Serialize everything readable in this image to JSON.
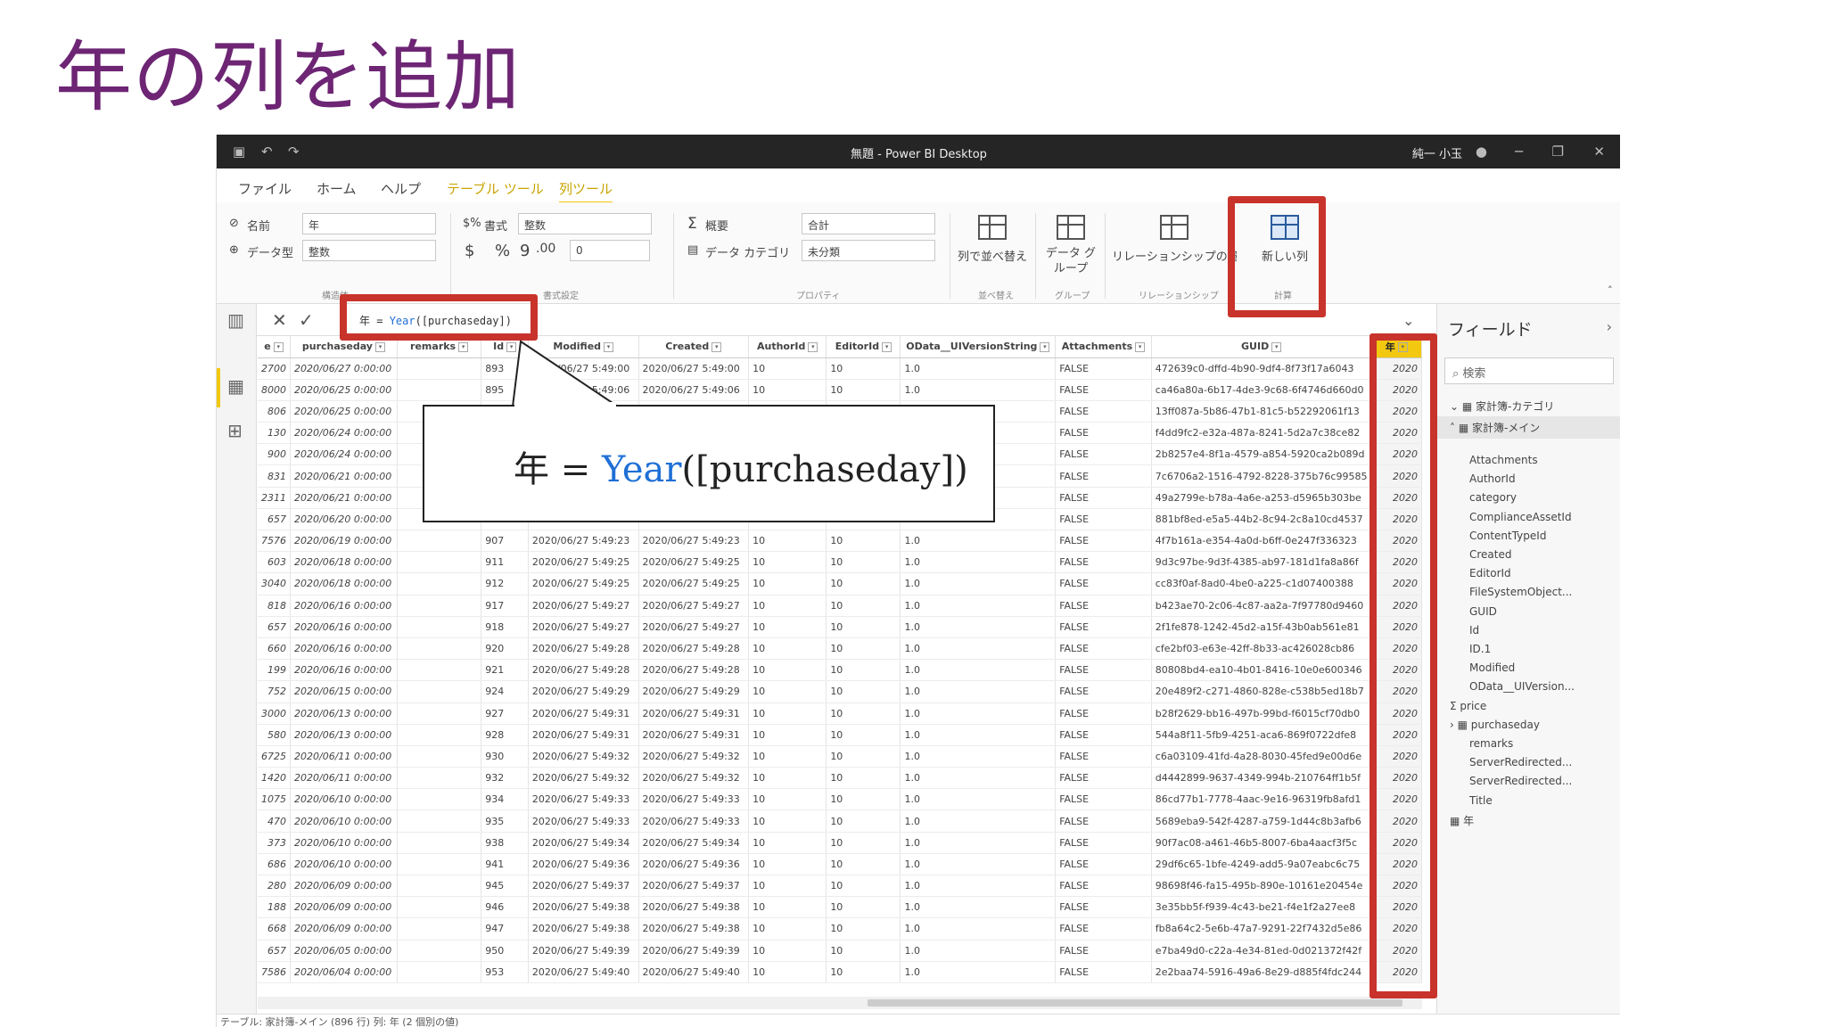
{
  "slide_title": "年の列を追加",
  "window": {
    "title": "無題 - Power BI Desktop",
    "user": "純一 小玉"
  },
  "menu": [
    "ファイル",
    "ホーム",
    "ヘルプ",
    "テーブル ツール",
    "列ツール"
  ],
  "ribbon": {
    "name_label": "名前",
    "name_value": "年",
    "datatype_label": "データ型",
    "datatype_value": "整数",
    "format_label": "書式",
    "format_value": "整数",
    "currency": "$",
    "percent": "%",
    "comma": "9",
    "decimals": "0",
    "summary_label": "概要",
    "summary_value": "合計",
    "category_label": "データ カテゴリ",
    "category_value": "未分類",
    "sort_label": "列で並べ替え",
    "group_label": "データ グループ",
    "relation_label": "リレーションシップの管理",
    "newcol_label": "新しい列",
    "groups": [
      "構造体",
      "書式設定",
      "プロパティ",
      "並べ替え",
      "グループ",
      "リレーションシップ",
      "計算"
    ]
  },
  "formula": {
    "prefix": "年 = ",
    "fn": "Year",
    "arg": "([purchaseday])"
  },
  "callout": {
    "prefix": "年 = ",
    "fn": "Year",
    "arg": "([purchaseday])"
  },
  "table": {
    "headers": [
      "e",
      "purchaseday",
      "remarks",
      "Id",
      "Modified",
      "Created",
      "AuthorId",
      "EditorId",
      "OData__UIVersionString",
      "Attachments",
      "GUID",
      "年"
    ],
    "rows": [
      [
        "2700",
        "2020/06/27 0:00:00",
        "",
        "893",
        "2020/06/27 5:49:00",
        "2020/06/27 5:49:00",
        "10",
        "10",
        "1.0",
        "FALSE",
        "472639c0-dffd-4b90-9df4-8f73f17a6043",
        "2020"
      ],
      [
        "8000",
        "2020/06/25 0:00:00",
        "",
        "895",
        "2020/06/27 5:49:06",
        "2020/06/27 5:49:06",
        "10",
        "10",
        "1.0",
        "FALSE",
        "ca46a80a-6b17-4de3-9c68-6f4746d660d0",
        "2020"
      ],
      [
        "806",
        "2020/06/25 0:00:00",
        "",
        "",
        "",
        "",
        "",
        "",
        "",
        "FALSE",
        "13ff087a-5b86-47b1-81c5-b52292061f13",
        "2020"
      ],
      [
        "130",
        "2020/06/24 0:00:00",
        "",
        "",
        "",
        "",
        "",
        "",
        "",
        "FALSE",
        "f4dd9fc2-e32a-487a-8241-5d2a7c38ce82",
        "2020"
      ],
      [
        "900",
        "2020/06/24 0:00:00",
        "",
        "",
        "",
        "",
        "",
        "",
        "",
        "FALSE",
        "2b8257e4-8f1a-4579-a854-5920ca2b089d",
        "2020"
      ],
      [
        "831",
        "2020/06/21 0:00:00",
        "",
        "",
        "",
        "",
        "",
        "",
        "",
        "FALSE",
        "7c6706a2-1516-4792-8228-375b76c99585",
        "2020"
      ],
      [
        "2311",
        "2020/06/21 0:00:00",
        "",
        "",
        "",
        "",
        "",
        "",
        "",
        "FALSE",
        "49a2799e-b78a-4a6e-a253-d5965b303be",
        "2020"
      ],
      [
        "657",
        "2020/06/20 0:00:00",
        "",
        "",
        "",
        "",
        "",
        "",
        "",
        "FALSE",
        "881bf8ed-e5a5-44b2-8c94-2c8a10cd4537",
        "2020"
      ],
      [
        "7576",
        "2020/06/19 0:00:00",
        "",
        "907",
        "2020/06/27 5:49:23",
        "2020/06/27 5:49:23",
        "10",
        "10",
        "1.0",
        "FALSE",
        "4f7b161a-e354-4a0d-b6ff-0e247f336323",
        "2020"
      ],
      [
        "603",
        "2020/06/18 0:00:00",
        "",
        "911",
        "2020/06/27 5:49:25",
        "2020/06/27 5:49:25",
        "10",
        "10",
        "1.0",
        "FALSE",
        "9d3c97be-9d3f-4385-ab97-181d1fa8a86f",
        "2020"
      ],
      [
        "3040",
        "2020/06/18 0:00:00",
        "",
        "912",
        "2020/06/27 5:49:25",
        "2020/06/27 5:49:25",
        "10",
        "10",
        "1.0",
        "FALSE",
        "cc83f0af-8ad0-4be0-a225-c1d07400388",
        "2020"
      ],
      [
        "818",
        "2020/06/16 0:00:00",
        "",
        "917",
        "2020/06/27 5:49:27",
        "2020/06/27 5:49:27",
        "10",
        "10",
        "1.0",
        "FALSE",
        "b423ae70-2c06-4c87-aa2a-7f97780d9460",
        "2020"
      ],
      [
        "657",
        "2020/06/16 0:00:00",
        "",
        "918",
        "2020/06/27 5:49:27",
        "2020/06/27 5:49:27",
        "10",
        "10",
        "1.0",
        "FALSE",
        "2f1fe878-1242-45d2-a15f-43b0ab561e81",
        "2020"
      ],
      [
        "660",
        "2020/06/16 0:00:00",
        "",
        "920",
        "2020/06/27 5:49:28",
        "2020/06/27 5:49:28",
        "10",
        "10",
        "1.0",
        "FALSE",
        "cfe2bf03-e63e-42ff-8b33-ac426028cb86",
        "2020"
      ],
      [
        "199",
        "2020/06/16 0:00:00",
        "",
        "921",
        "2020/06/27 5:49:28",
        "2020/06/27 5:49:28",
        "10",
        "10",
        "1.0",
        "FALSE",
        "80808bd4-ea10-4b01-8416-10e0e600346",
        "2020"
      ],
      [
        "752",
        "2020/06/15 0:00:00",
        "",
        "924",
        "2020/06/27 5:49:29",
        "2020/06/27 5:49:29",
        "10",
        "10",
        "1.0",
        "FALSE",
        "20e489f2-c271-4860-828e-c538b5ed18b7",
        "2020"
      ],
      [
        "3000",
        "2020/06/13 0:00:00",
        "",
        "927",
        "2020/06/27 5:49:31",
        "2020/06/27 5:49:31",
        "10",
        "10",
        "1.0",
        "FALSE",
        "b28f2629-bb16-497b-99bd-f6015cf70db0",
        "2020"
      ],
      [
        "580",
        "2020/06/13 0:00:00",
        "",
        "928",
        "2020/06/27 5:49:31",
        "2020/06/27 5:49:31",
        "10",
        "10",
        "1.0",
        "FALSE",
        "544a8f11-5fb9-4251-aca6-869f0722dfe8",
        "2020"
      ],
      [
        "6725",
        "2020/06/11 0:00:00",
        "",
        "930",
        "2020/06/27 5:49:32",
        "2020/06/27 5:49:32",
        "10",
        "10",
        "1.0",
        "FALSE",
        "c6a03109-41fd-4a28-8030-45fed9e00d6e",
        "2020"
      ],
      [
        "1420",
        "2020/06/11 0:00:00",
        "",
        "932",
        "2020/06/27 5:49:32",
        "2020/06/27 5:49:32",
        "10",
        "10",
        "1.0",
        "FALSE",
        "d4442899-9637-4349-994b-210764ff1b5f",
        "2020"
      ],
      [
        "1075",
        "2020/06/10 0:00:00",
        "",
        "934",
        "2020/06/27 5:49:33",
        "2020/06/27 5:49:33",
        "10",
        "10",
        "1.0",
        "FALSE",
        "86cd77b1-7778-4aac-9e16-96319fb8afd1",
        "2020"
      ],
      [
        "470",
        "2020/06/10 0:00:00",
        "",
        "935",
        "2020/06/27 5:49:33",
        "2020/06/27 5:49:33",
        "10",
        "10",
        "1.0",
        "FALSE",
        "5689eba9-542f-4287-a759-1d44c8b3afb6",
        "2020"
      ],
      [
        "373",
        "2020/06/10 0:00:00",
        "",
        "938",
        "2020/06/27 5:49:34",
        "2020/06/27 5:49:34",
        "10",
        "10",
        "1.0",
        "FALSE",
        "90f7ac08-a461-46b5-8007-6ba4aacf3f5c",
        "2020"
      ],
      [
        "686",
        "2020/06/10 0:00:00",
        "",
        "941",
        "2020/06/27 5:49:36",
        "2020/06/27 5:49:36",
        "10",
        "10",
        "1.0",
        "FALSE",
        "29df6c65-1bfe-4249-add5-9a07eabc6c75",
        "2020"
      ],
      [
        "280",
        "2020/06/09 0:00:00",
        "",
        "945",
        "2020/06/27 5:49:37",
        "2020/06/27 5:49:37",
        "10",
        "10",
        "1.0",
        "FALSE",
        "98698f46-fa15-495b-890e-10161e20454e",
        "2020"
      ],
      [
        "188",
        "2020/06/09 0:00:00",
        "",
        "946",
        "2020/06/27 5:49:38",
        "2020/06/27 5:49:38",
        "10",
        "10",
        "1.0",
        "FALSE",
        "3e35bb5f-f939-4c43-be21-f4e1f2a27ee8",
        "2020"
      ],
      [
        "668",
        "2020/06/09 0:00:00",
        "",
        "947",
        "2020/06/27 5:49:38",
        "2020/06/27 5:49:38",
        "10",
        "10",
        "1.0",
        "FALSE",
        "fb8a64c2-5e6b-47a7-9291-22f7432d5e86",
        "2020"
      ],
      [
        "657",
        "2020/06/05 0:00:00",
        "",
        "950",
        "2020/06/27 5:49:39",
        "2020/06/27 5:49:39",
        "10",
        "10",
        "1.0",
        "FALSE",
        "e7ba49d0-c22a-4e34-81ed-0d021372f42f",
        "2020"
      ],
      [
        "7586",
        "2020/06/04 0:00:00",
        "",
        "953",
        "2020/06/27 5:49:40",
        "2020/06/27 5:49:40",
        "10",
        "10",
        "1.0",
        "FALSE",
        "2e2baa74-5916-49a6-8e29-d885f4fdc244",
        "2020"
      ]
    ]
  },
  "fields": {
    "title": "フィールド",
    "search_placeholder": "検索",
    "tables": [
      "家計簿-カテゴリ",
      "家計簿-メイン"
    ],
    "items": [
      "Attachments",
      "AuthorId",
      "category",
      "ComplianceAssetId",
      "ContentTypeId",
      "Created",
      "EditorId",
      "FileSystemObject...",
      "GUID",
      "Id",
      "ID.1",
      "Modified",
      "OData__UIVersion...",
      "price",
      "purchaseday",
      "remarks",
      "ServerRedirected...",
      "ServerRedirected...",
      "Title",
      "年"
    ]
  },
  "status": "テーブル: 家計簿-メイン (896 行) 列: 年 (2 個別の値)",
  "colors": {
    "highlight": "#c8332b",
    "accent": "#f2c811",
    "title": "#6d2574"
  }
}
